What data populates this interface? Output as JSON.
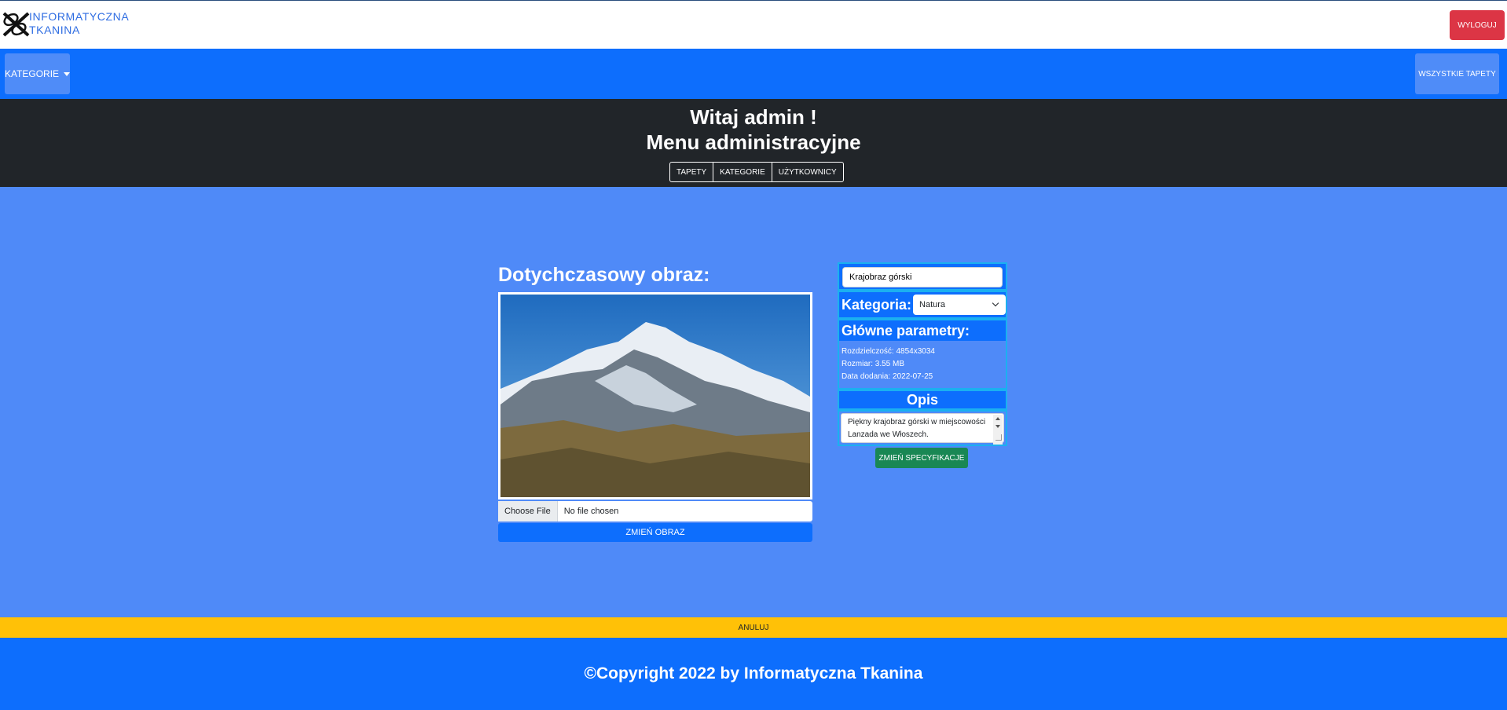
{
  "header": {
    "brand_line1": "INFORMATYCZNA",
    "brand_line2": "TKANINA",
    "logout_label": "WYLOGUJ"
  },
  "navbar": {
    "categories_label": "KATEGORIE",
    "all_wallpapers_label": "WSZYSTKIE TAPETY"
  },
  "admin": {
    "greeting": "Witaj admin !",
    "menu_title": "Menu administracyjne",
    "tabs": [
      "TAPETY",
      "KATEGORIE",
      "UŻYTKOWNICY"
    ]
  },
  "image_section": {
    "current_image_label": "Dotychczasowy obraz:",
    "image_description": "Krajobraz górski",
    "choose_file_label": "Choose File",
    "file_status": "No file chosen",
    "change_image_label": "ZMIEŃ OBRAZ"
  },
  "spec": {
    "name_value": "Krajobraz górski",
    "category_label": "Kategoria:",
    "category_value": "Natura",
    "params_title": "Główne parametry:",
    "resolution": "Rozdzielczość: 4854x3034",
    "size": "Rozmiar: 3.55 MB",
    "date_added": "Data dodania: 2022-07-25",
    "description_title": "Opis",
    "description_value": "Piękny krajobraz górski w miejscowości Lanzada we Włoszech.",
    "change_spec_label": "ZMIEŃ SPECYFIKACJE"
  },
  "cancel_label": "ANULUJ",
  "footer_text": "©Copyright 2022 by Informatyczna Tkanina",
  "colors": {
    "primary": "#0d6efd",
    "background": "#4f8af8",
    "dark": "#212529",
    "danger": "#dc3545",
    "success": "#198754",
    "warning": "#ffc107"
  }
}
